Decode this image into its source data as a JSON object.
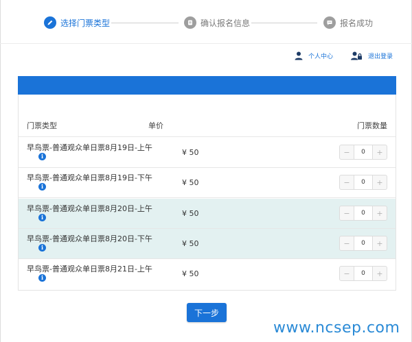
{
  "steps": [
    {
      "label": "选择门票类型",
      "state": "active",
      "icon": "pencil-icon"
    },
    {
      "label": "确认报名信息",
      "state": "inactive",
      "icon": "document-icon"
    },
    {
      "label": "报名成功",
      "state": "inactive",
      "icon": "message-icon"
    }
  ],
  "userbar": {
    "personal_center": "个人中心",
    "logout": "退出登录"
  },
  "table": {
    "headers": {
      "type": "门票类型",
      "price": "单价",
      "quantity": "门票数量"
    },
    "rows": [
      {
        "name": "早鸟票-普通观众单日票8月19日-上午",
        "price": "¥ 50",
        "qty": "0",
        "highlighted": false
      },
      {
        "name": "早鸟票-普通观众单日票8月19日-下午",
        "price": "¥ 50",
        "qty": "0",
        "highlighted": false
      },
      {
        "name": "早鸟票-普通观众单日票8月20日-上午",
        "price": "¥ 50",
        "qty": "0",
        "highlighted": true
      },
      {
        "name": "早鸟票-普通观众单日票8月20日-下午",
        "price": "¥ 50",
        "qty": "0",
        "highlighted": true
      },
      {
        "name": "早鸟票-普通观众单日票8月21日-上午",
        "price": "¥ 50",
        "qty": "0",
        "highlighted": false
      }
    ],
    "minus": "−",
    "plus": "+",
    "info_glyph": "i"
  },
  "next_button": "下一步",
  "watermark": "www.ncsep.com",
  "colors": {
    "accent": "#1a73d8",
    "row_highlight": "#e3f1f1",
    "watermark": "#2a8ad6"
  }
}
